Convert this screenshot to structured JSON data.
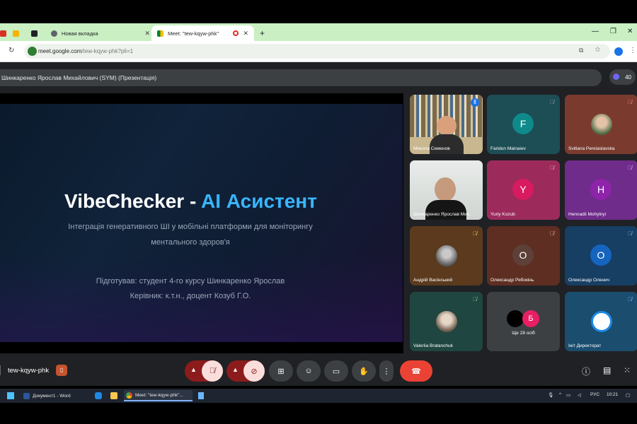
{
  "browser": {
    "tabs": [
      {
        "label": "Новая вкладка",
        "active": false
      },
      {
        "label": "Meet: \"tew-kqyw-phk\"",
        "active": true
      }
    ],
    "new_tab_label": "+",
    "address": {
      "domain": "meet.google.com",
      "path": "/tew-kqyw-phk?pli=1"
    }
  },
  "meet": {
    "presenter_label": "Шинкаренко Ярослав Михайлович (SYM) (Презентація)",
    "participant_count": "40",
    "meeting_code": "tew-kqyw-phk",
    "slide": {
      "title_main": "VibeChecker - ",
      "title_accent": "AI Асистент",
      "subtitle_line1": "Інтеграція генеративного ШІ у мобільні платформи для моніторингу",
      "subtitle_line2": "ментального здоров'я",
      "author_line": "Підготував: студент 4-го курсу Шинкаренко Ярослав",
      "supervisor_line": "Керівник: к.т.н., доцент Козуб Г.О."
    },
    "participants": [
      {
        "name": "Микола Семенов",
        "kind": "video"
      },
      {
        "name": "Faridun Mainaiev",
        "initial": "F",
        "color": "#0f8a8a",
        "bg": "#1d4d55"
      },
      {
        "name": "Svitlana Pereiaslavska",
        "kind": "photo",
        "bg": "#7a3b2e"
      },
      {
        "name": "Шинкаренко Ярослав Мих...",
        "kind": "video"
      },
      {
        "name": "Yuriy Kozub",
        "initial": "Y",
        "color": "#d81b60",
        "bg": "#9c2b5c"
      },
      {
        "name": "Hennadii Mohylnyi",
        "initial": "H",
        "color": "#8e24aa",
        "bg": "#6f2c8a"
      },
      {
        "name": "Андрій Васінський",
        "kind": "photo",
        "bg": "#5b3a1e"
      },
      {
        "name": "Олександр Рябокінь",
        "initial": "О",
        "color": "#5d4037",
        "bg": "#5e2e22"
      },
      {
        "name": "Олександр Оленич",
        "initial": "О",
        "color": "#1565c0",
        "bg": "#173e63"
      },
      {
        "name": "Valeriia Bratanchuk",
        "kind": "photo",
        "bg": "#1f4640"
      },
      {
        "name": "Ще 28 осіб",
        "initial": "Б",
        "color": "#e91e63",
        "bg": "#3c4043"
      },
      {
        "name": "Ініт Директорат",
        "kind": "logo",
        "bg": "#1a4d6e"
      }
    ]
  },
  "taskbar": {
    "items": [
      {
        "label": "Документ1 - Word"
      },
      {
        "label": "Meet: \"tew-kqyw-phk\"..."
      }
    ],
    "lang": "РУС",
    "time": "10:21"
  }
}
